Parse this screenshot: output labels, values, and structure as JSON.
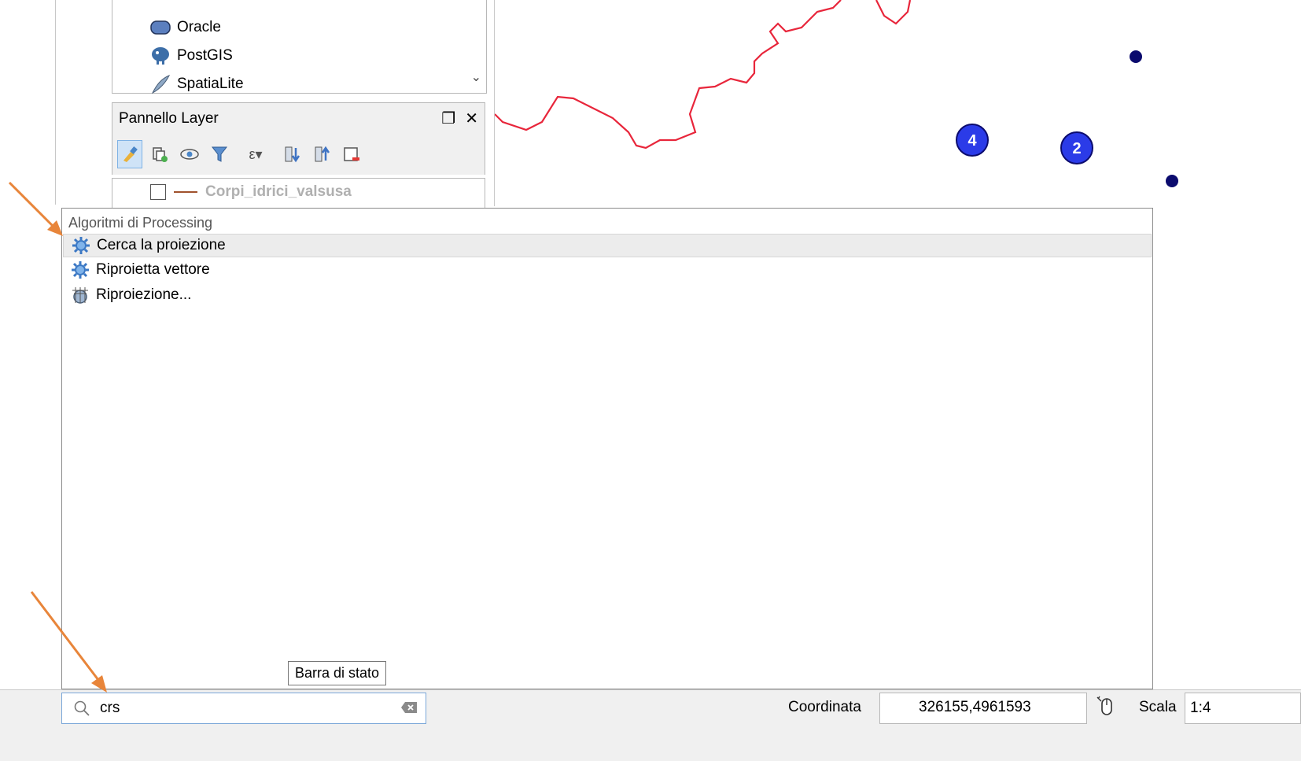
{
  "browser_panel": {
    "items": [
      {
        "label": "Oracle",
        "icon": "oracle-db-icon"
      },
      {
        "label": "PostGIS",
        "icon": "postgis-elephant-icon"
      },
      {
        "label": "SpatiaLite",
        "icon": "spatialite-feather-icon"
      }
    ]
  },
  "layers_panel": {
    "title": "Pannello Layer",
    "float_icon": "float-window-icon",
    "close_icon": "close-icon",
    "toolbar_icons": [
      "style-icon",
      "add-group-icon",
      "visibility-icon",
      "filter-icon",
      "expression-filter-icon",
      "expand-all-icon",
      "collapse-all-icon",
      "remove-layer-icon"
    ],
    "layers": [
      {
        "name": "Corpi_idrici_valsusa",
        "checked": false
      }
    ]
  },
  "map": {
    "cluster_labels": [
      "4",
      "2"
    ],
    "line_color": "#e8263b",
    "point_color": "#0b0b6e",
    "cluster_color": "#2b3be8"
  },
  "locator_results": {
    "group_header": "Algoritmi di Processing",
    "items": [
      {
        "label": "Cerca la proiezione",
        "icon": "processing-gear-icon",
        "selected": true
      },
      {
        "label": "Riproietta vettore",
        "icon": "processing-gear-icon",
        "selected": false
      },
      {
        "label": "Riproiezione...",
        "icon": "globe-grid-icon",
        "selected": false
      }
    ]
  },
  "tooltip": "Barra di stato",
  "statusbar": {
    "search_value": "crs",
    "coord_label": "Coordinata",
    "coord_value": "326155,4961593",
    "scale_label": "Scala",
    "scale_value": "1:4"
  },
  "annotation_color": "#e8853a"
}
